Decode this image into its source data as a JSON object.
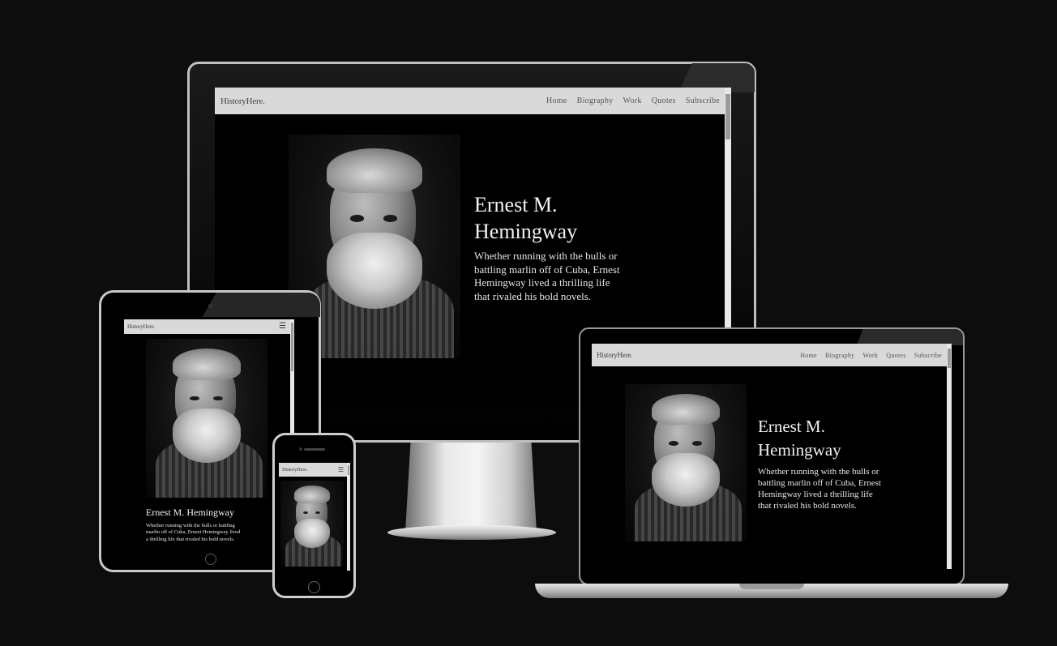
{
  "site": {
    "brand": "HistoryHere.",
    "nav": [
      "Home",
      "Biography",
      "Work",
      "Quotes",
      "Subscribe"
    ],
    "menu_icon": "hamburger-icon",
    "hero": {
      "title_line1": "Ernest M.",
      "title_line2": "Hemingway",
      "title_full": "Ernest M. Hemingway",
      "lead_lines": [
        "Whether running with the bulls or",
        "battling marlin off of Cuba, Ernest",
        "Hemingway lived a thrilling life",
        "that rivaled his bold novels."
      ],
      "tablet_lead_lines": [
        "Whether running with the bulls or battling",
        "marlin off of Cuba, Ernest Hemingway lived",
        "a thrilling life that rivaled his bold novels."
      ]
    }
  },
  "colors": {
    "background": "#0d0d0d",
    "nav_bar": "#d9d9d9",
    "screen": "#000000",
    "device_frame": "#bfbfbf"
  }
}
